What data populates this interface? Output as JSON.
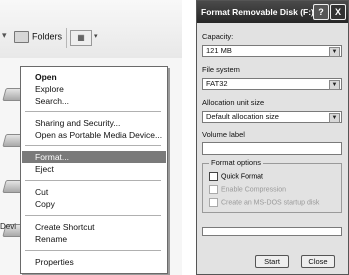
{
  "explorer": {
    "toolbar": {
      "folders_label": "Folders",
      "views_icon": "views-grid-icon"
    },
    "partial_text": "Devi"
  },
  "context_menu": {
    "items": [
      {
        "label": "Open",
        "bold": true
      },
      {
        "label": "Explore"
      },
      {
        "label": "Search..."
      },
      {
        "label": "Sharing and Security..."
      },
      {
        "label": "Open as Portable Media Device..."
      },
      {
        "label": "Format...",
        "highlighted": true
      },
      {
        "label": "Eject"
      },
      {
        "label": "Cut"
      },
      {
        "label": "Copy"
      },
      {
        "label": "Create Shortcut"
      },
      {
        "label": "Rename"
      },
      {
        "label": "Properties"
      }
    ]
  },
  "dialog": {
    "title": "Format Removable Disk (F:)",
    "help_label": "?",
    "close_label": "X",
    "capacity": {
      "label": "Capacity:",
      "value": "121 MB"
    },
    "file_system": {
      "label": "File system",
      "value": "FAT32"
    },
    "allocation": {
      "label": "Allocation unit size",
      "value": "Default allocation size"
    },
    "volume_label": {
      "label": "Volume label",
      "value": ""
    },
    "format_options": {
      "title": "Format options",
      "quick_format": "Quick Format",
      "enable_compression": "Enable Compression",
      "create_msdos": "Create an MS-DOS startup disk"
    },
    "start_label": "Start",
    "close_button_label": "Close"
  },
  "colors": {
    "titlebar": "#2e2e2e",
    "menu_highlight": "#7a7a7a",
    "dialog_bg": "#e2e2dc"
  }
}
